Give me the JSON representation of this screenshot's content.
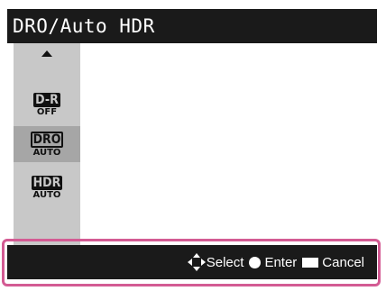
{
  "title": "DRO/Auto HDR",
  "menu": {
    "items": [
      {
        "top": "D-R",
        "bottom": "OFF",
        "selected": false,
        "style": "solid"
      },
      {
        "top": "DRO",
        "bottom": "AUTO",
        "selected": true,
        "style": "outline"
      },
      {
        "top": "HDR",
        "bottom": "AUTO",
        "selected": false,
        "style": "solid"
      }
    ]
  },
  "footer": {
    "select_label": "Select",
    "enter_label": "Enter",
    "cancel_label": "Cancel"
  },
  "colors": {
    "bar": "#1a1a1a",
    "menu_bg": "#c8c8c8",
    "selected_bg": "#a6a6a6",
    "highlight_frame": "#d35b93"
  }
}
